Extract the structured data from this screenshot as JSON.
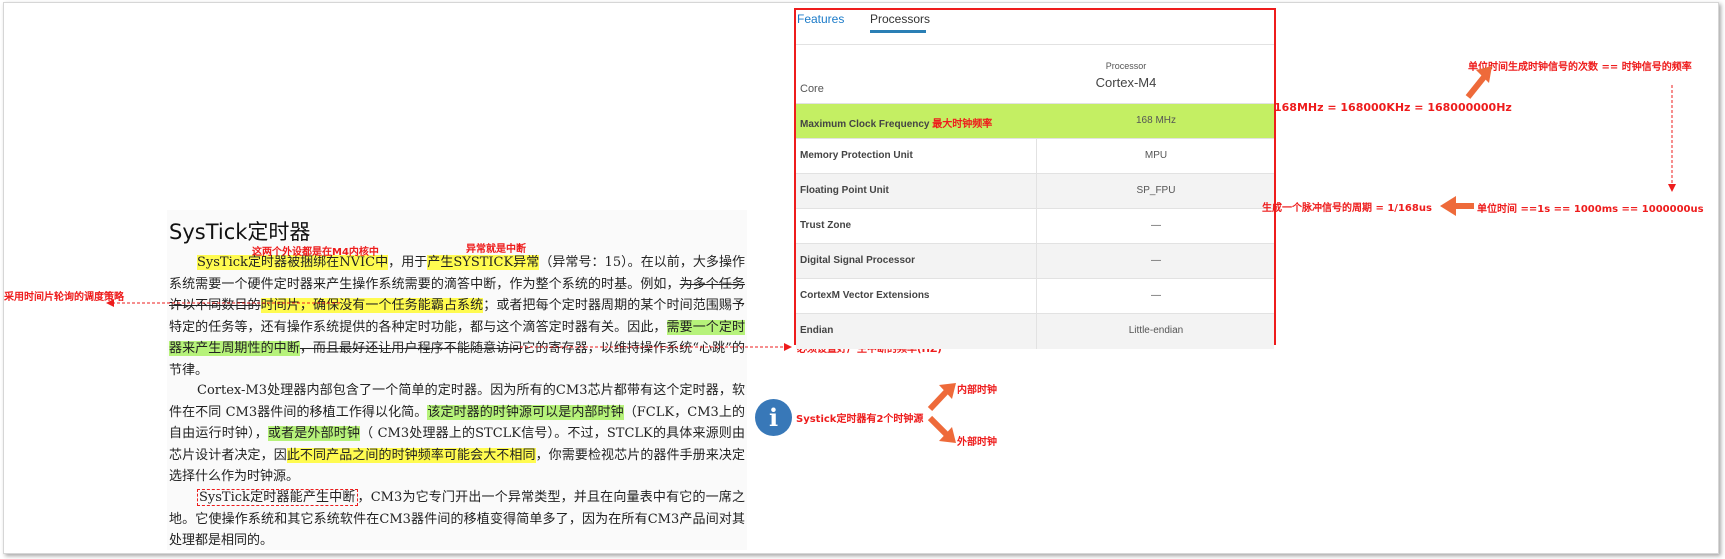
{
  "document": {
    "title": "SysTick定时器",
    "p1": {
      "a": "SysTick定时器被捆绑在NVIC中",
      "b": "，用于",
      "c": "产生SYSTICK异常",
      "d": "（异常号：15）。在以前，大多操作系统需要一个硬件定时器来产生操作系统需要的滴答中断，作为整个系统的时基。例如，",
      "e": "为多个任务许以不同数目的",
      "f": "时间片，确保没有一个任务能霸占系统",
      "g": "；或者把每个定时器周期的某个时间范围赐予特定的任务等，还有操作系统提供的各种定时功能，都与这个滴答定时器有关。因此，",
      "h": "需要一个定时器来产生周期性的中断",
      "i": "，而且最好还让用户程序不能随意访问",
      "j": "它的寄存器，以维持操作系统“心跳”的节律。"
    },
    "p2": {
      "a": "Cortex-M3处理器内部包含了一个简单的定时器。因为所有的CM3芯片都带有这个定时器，软件在不同  CM3器件间的移植工作得以化简。",
      "b": "该定时器的时钟源可以是内部时钟",
      "c": "（FCLK，CM3上的自由运行时钟），",
      "d": "或者是外部时钟",
      "e": "（  CM3处理器上的STCLK信号）。不过，STCLK的具体来源则由芯片设计者决定，因",
      "f": "此不同产品之间的时钟频率可能会大不相同",
      "g": "，你需要检视芯片的器件手册来决定选择什么作为时钟源。"
    },
    "p3": {
      "a": "SysTick定时器能产生中断",
      "b": "，CM3为它专门开出一个异常类型，并且在向量表中有它的一席之地。它使操作系统和其它系统软件在CM3器件间的移植变得简单多了，因为在所有CM3产品间对其处理都是相同的。"
    }
  },
  "table": {
    "tabs": [
      "Features",
      "Processors"
    ],
    "active_tab": "Processors",
    "header": {
      "col1": "Core",
      "col2_small": "Processor",
      "col2_big": "Cortex-M4"
    },
    "rows": [
      {
        "label": "Maximum Clock Frequency",
        "note": "最大时钟频率",
        "value": "168 MHz"
      },
      {
        "label": "Memory Protection Unit",
        "value": "MPU"
      },
      {
        "label": "Floating Point Unit",
        "value": "SP_FPU"
      },
      {
        "label": "Trust Zone",
        "value": "—"
      },
      {
        "label": "Digital Signal Processor",
        "value": "—"
      },
      {
        "label": "CortexM Vector Extensions",
        "value": "—"
      },
      {
        "label": "Endian",
        "value": "Little-endian"
      }
    ]
  },
  "annotations": {
    "nvic_note": "这两个外设都是在M4内核中",
    "exception_note": "异常就是中断",
    "timeslice_note": "采用时间片轮询的调度策略",
    "interrupt_freq_note": "必须设置好产生中断的频率(HZ)",
    "two_sources": "Systick定时器有2个时钟源",
    "internal_clock": "内部时钟",
    "external_clock": "外部时钟",
    "freq_conversion": "168MHz = 168000KHz  = 168000000Hz",
    "freq_definition": "单位时间生成时钟信号的次数  == 时钟信号的频率",
    "period_note": "生成一个脉冲信号的周期 = 1/168us",
    "unit_time": "单位时间 ==1s == 1000ms == 1000000us"
  },
  "colors": {
    "annotation_red": "#ee1c1c",
    "highlight_yellow": "#fffb50",
    "highlight_green": "#b6f27a",
    "row_highlight": "#c4ef63",
    "tab_blue": "#1a7ac8",
    "info_blue": "#3878b8"
  },
  "icons": {
    "info": "info-icon"
  }
}
